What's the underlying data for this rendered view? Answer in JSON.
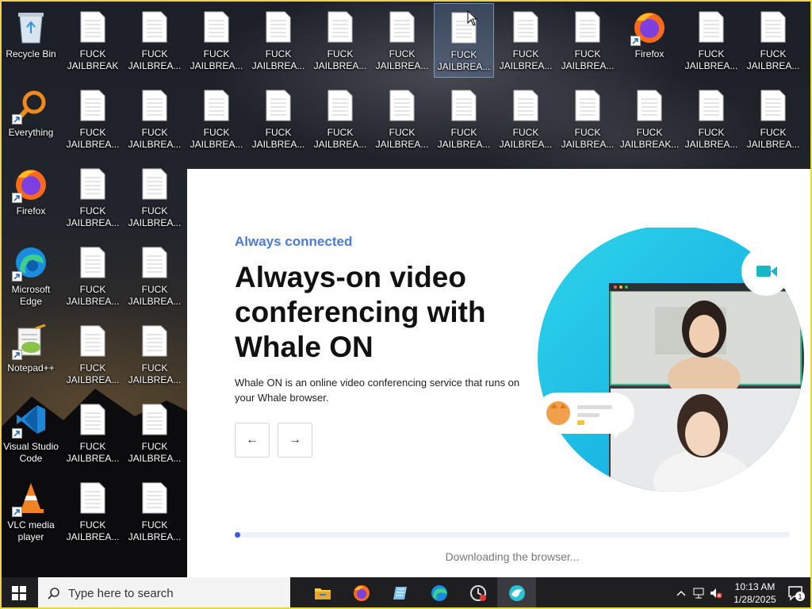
{
  "desktop": {
    "recycle_bin": "Recycle Bin",
    "everything": "Everything",
    "firefox": "Firefox",
    "edge": "Microsoft Edge",
    "notepadpp": "Notepad++",
    "vscode": "Visual Studio Code",
    "vlc": "VLC media player",
    "file_label_full": "FUCK JAILBREAK",
    "file_label_trunc": "FUCK JAILBREA...",
    "file_label_trunc2": "FUCK JAILBREAK..."
  },
  "installer": {
    "eyebrow": "Always connected",
    "headline": "Always-on video conferencing with Whale ON",
    "description": "Whale ON is an online video conferencing service that runs on your Whale browser.",
    "prev_glyph": "←",
    "next_glyph": "→",
    "progress": 0.01,
    "status": "Downloading the browser...",
    "accent": "#4a7bd6"
  },
  "taskbar": {
    "search_placeholder": "Type here to search",
    "time": "10:13 AM",
    "date": "1/28/2025",
    "notifications": "1"
  }
}
